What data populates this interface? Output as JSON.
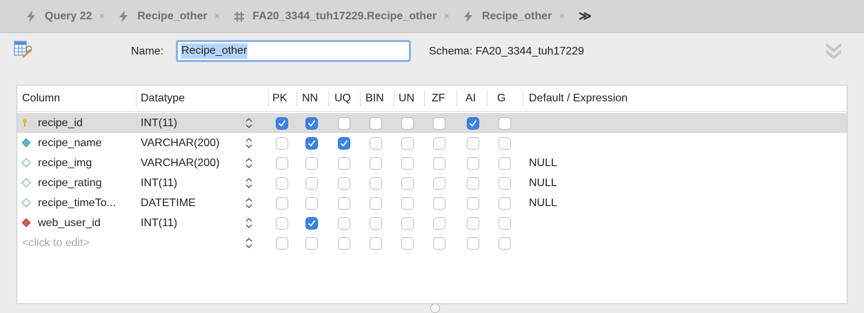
{
  "tabs": [
    {
      "label": "Query 22",
      "icon": "lightning-icon"
    },
    {
      "label": "Recipe_other",
      "icon": "lightning-icon"
    },
    {
      "label": "FA20_3344_tuh17229.Recipe_other",
      "icon": "table-hash-icon"
    },
    {
      "label": "Recipe_other",
      "icon": "lightning-icon"
    }
  ],
  "tab_close_glyph": "×",
  "tab_overflow_glyph": "≫",
  "editor": {
    "name_label": "Name:",
    "name_value": "Recipe_other",
    "schema_text": "Schema: FA20_3344_tuh17229"
  },
  "columns_header": {
    "column": "Column",
    "datatype": "Datatype",
    "pk": "PK",
    "nn": "NN",
    "uq": "UQ",
    "bin": "BIN",
    "un": "UN",
    "zf": "ZF",
    "ai": "AI",
    "g": "G",
    "default": "Default / Expression"
  },
  "rows": [
    {
      "name": "recipe_id",
      "datatype": "INT(11)",
      "key_icon": "primary-key-icon",
      "flags": [
        true,
        true,
        false,
        false,
        false,
        false,
        true,
        false
      ],
      "default": "",
      "selected": true
    },
    {
      "name": "recipe_name",
      "datatype": "VARCHAR(200)",
      "key_icon": "unique-index-icon",
      "flags": [
        false,
        true,
        true,
        false,
        false,
        false,
        false,
        false
      ],
      "default": ""
    },
    {
      "name": "recipe_img",
      "datatype": "VARCHAR(200)",
      "key_icon": "column-icon",
      "flags": [
        false,
        false,
        false,
        false,
        false,
        false,
        false,
        false
      ],
      "default": "NULL"
    },
    {
      "name": "recipe_rating",
      "datatype": "INT(11)",
      "key_icon": "column-icon",
      "flags": [
        false,
        false,
        false,
        false,
        false,
        false,
        false,
        false
      ],
      "default": "NULL"
    },
    {
      "name": "recipe_timeTo...",
      "datatype": "DATETIME",
      "key_icon": "column-icon",
      "flags": [
        false,
        false,
        false,
        false,
        false,
        false,
        false,
        false
      ],
      "default": "NULL"
    },
    {
      "name": "web_user_id",
      "datatype": "INT(11)",
      "key_icon": "foreign-key-icon",
      "flags": [
        false,
        true,
        false,
        false,
        false,
        false,
        false,
        false
      ],
      "default": ""
    }
  ],
  "new_row_placeholder": "<click to edit>",
  "colors": {
    "accent": "#3b82e6",
    "selected_row": "#dcdcdc",
    "pk_key": "#f0c030",
    "unique_diamond": "#5ab7c9",
    "fk_diamond": "#d85a52"
  }
}
